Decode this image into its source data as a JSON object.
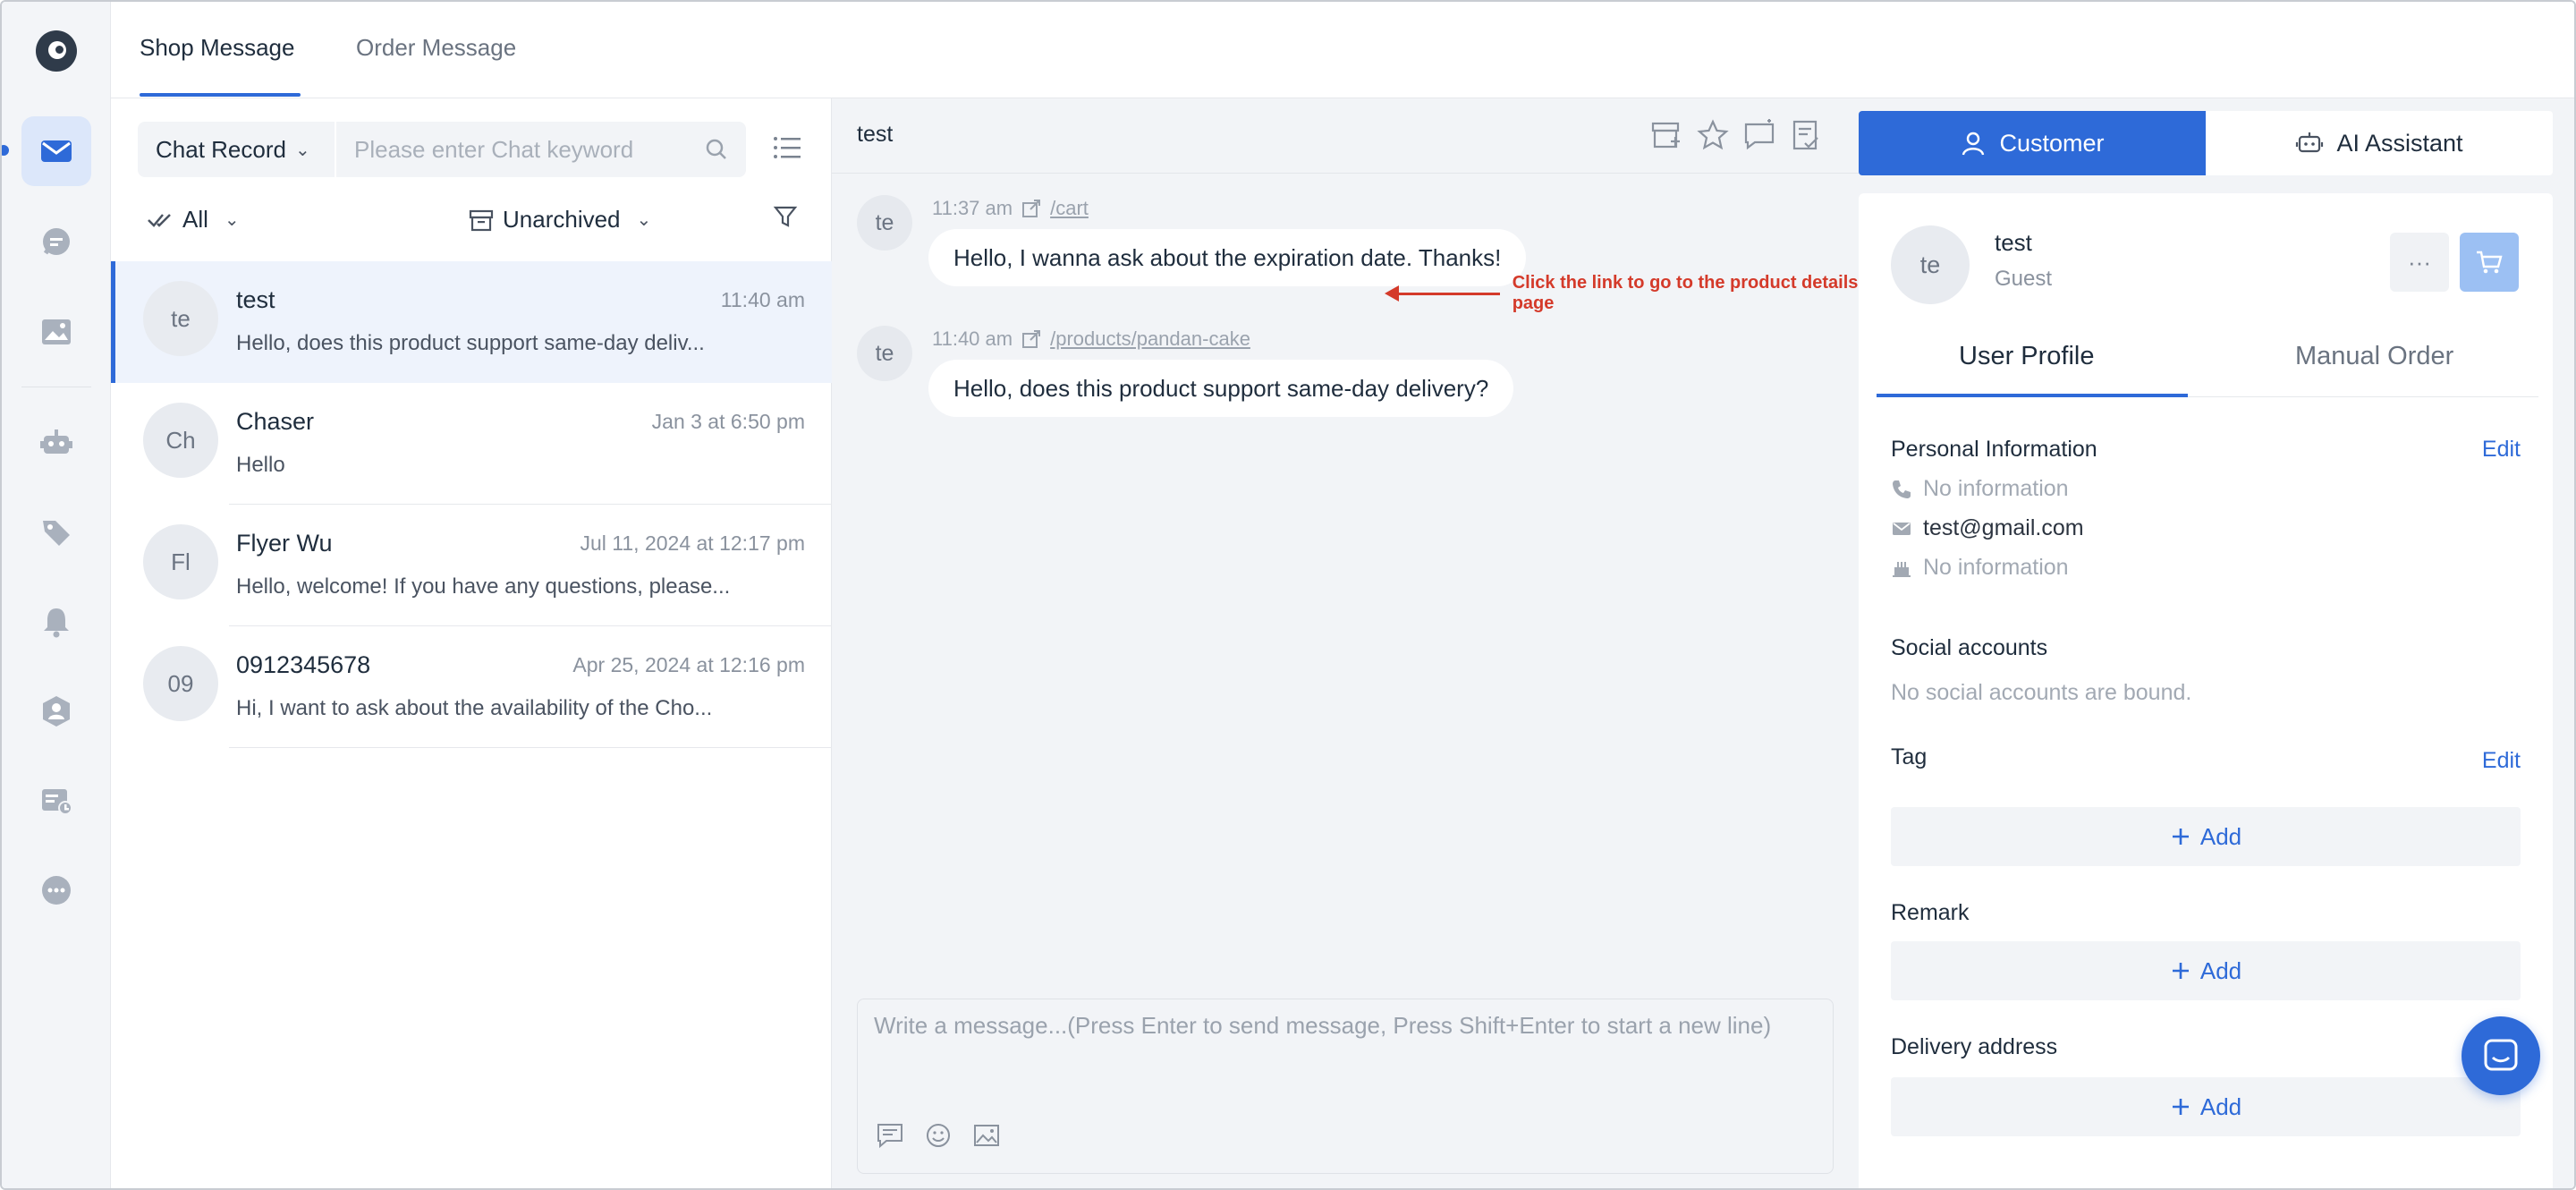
{
  "top_tabs": [
    "Shop Message",
    "Order Message"
  ],
  "list": {
    "filter_select": "Chat Record",
    "search_placeholder": "Please enter Chat keyword",
    "filter_all": "All",
    "filter_archive": "Unarchived",
    "conversations": [
      {
        "initials": "te",
        "name": "test",
        "time": "11:40 am",
        "preview": "Hello, does this product support same-day deliv..."
      },
      {
        "initials": "Ch",
        "name": "Chaser",
        "time": "Jan 3 at 6:50 pm",
        "preview": "Hello"
      },
      {
        "initials": "Fl",
        "name": "Flyer Wu",
        "time": "Jul 11, 2024 at 12:17 pm",
        "preview": "Hello, welcome! If you have any questions, please..."
      },
      {
        "initials": "09",
        "name": "0912345678",
        "time": "Apr 25, 2024 at 12:16 pm",
        "preview": "Hi, I want to ask about the availability of the Cho..."
      }
    ]
  },
  "chat": {
    "title": "test",
    "messages": [
      {
        "initials": "te",
        "time": "11:37 am",
        "link": "/cart",
        "text": "Hello, I wanna ask about the expiration date. Thanks!"
      },
      {
        "initials": "te",
        "time": "11:40 am",
        "link": "/products/pandan-cake",
        "text": "Hello, does this product support same-day delivery?"
      }
    ],
    "annotation": "Click the link to go to the product details page",
    "compose_placeholder": "Write a message...(Press Enter to send message, Press Shift+Enter to start a new line)"
  },
  "right": {
    "tabs": [
      "Customer",
      "AI Assistant"
    ],
    "user": {
      "initials": "te",
      "name": "test",
      "role": "Guest",
      "more": "···"
    },
    "profile_tabs": [
      "User Profile",
      "Manual Order"
    ],
    "personal_title": "Personal Information",
    "edit": "Edit",
    "phone": "No information",
    "email": "test@gmail.com",
    "birthday": "No information",
    "social_title": "Social accounts",
    "social_empty": "No social accounts are bound.",
    "tag_title": "Tag",
    "remark_title": "Remark",
    "delivery_title": "Delivery address",
    "add": "Add"
  },
  "colors": {
    "accent": "#2e6ad8",
    "annotation": "#d43a2a"
  }
}
